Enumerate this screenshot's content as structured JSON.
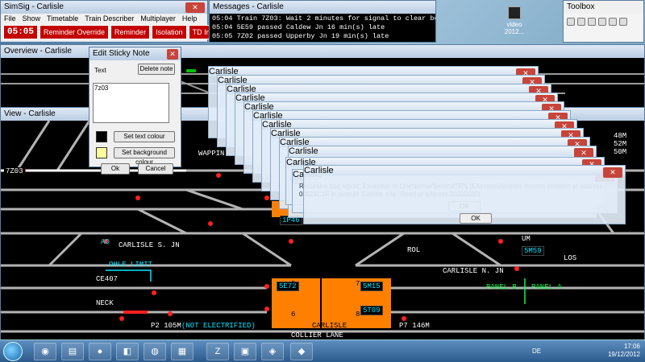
{
  "simsig": {
    "title": "SimSig - Carlisle",
    "menu": [
      "File",
      "Show",
      "Timetable",
      "Train Describer",
      "Multiplayer",
      "Help"
    ],
    "clock": "05:05",
    "buttons": [
      "Reminder Override",
      "Reminder",
      "Isolation",
      "TD Interpose"
    ]
  },
  "messages": {
    "title": "Messages - Carlisle",
    "lines": [
      "05:04 Train 7Z03: Wait 2 minutes for signal to clear before phoning",
      "05:04 5E59 passed Caldew Jn 16 min(s) late",
      "05:05 7Z02 passed Upperby Jn 19 min(s) late"
    ]
  },
  "toolbox": {
    "title": "Toolbox"
  },
  "desktop_icon": {
    "label": "video 2012..."
  },
  "overview": {
    "title": "Overview - Carlisle"
  },
  "view": {
    "title": "View - Carlisle",
    "labels": {
      "carlisle_s_jn": "CARLISLE S. JN",
      "carlisle_n_jn": "CARLISLE N. JN",
      "ohle_limit": "OHLE LIMIT",
      "ce407": "CE407",
      "neck": "NECK",
      "carlisle": "CARLISLE",
      "wapping": "WAPPIN",
      "p2": "P2 105M",
      "not_electrified": "(NOT ELECTRIFIED)",
      "p7": "P7 146M",
      "rol": "ROL",
      "los": "LOS",
      "um": "UM",
      "panel_b": "PANEL B",
      "panel_a": "PANEL A",
      "m48": "48M",
      "m52": "52M",
      "m50": "50M",
      "collier_lane": "COLLIER LANE",
      "ao": "AO"
    },
    "berths": {
      "b7z03": "7Z03",
      "b1p46": "1P46",
      "b5e72": "5E72",
      "b5m15": "5M15",
      "b5t09": "5T09",
      "b5m59": "5M59",
      "b5p6": "5",
      "b7p": "7",
      "b6p": "6",
      "b8p": "8"
    }
  },
  "sticky": {
    "title": "Edit Sticky Note",
    "text_label": "Text",
    "delete_label": "Delete note",
    "note_text": "7z03",
    "text_colour_label": "Set text colour",
    "bg_colour_label": "Set background colour",
    "ok_label": "Ok",
    "cancel_label": "Cancel",
    "text_colour": "#000000",
    "bg_colour": "#ffffa0"
  },
  "errors": {
    "window_title": "Carlisle",
    "message": "Recursive bug report: Exception in OneNormalSecondTRN (EAccessViolation: Access violation at address 00524C1F in module 'Carlisle.exe'. Read of address 00000000)",
    "ok_label": "OK"
  },
  "taskbar": {
    "lang": "DE",
    "time": "17:06",
    "date": "19/12/2012"
  }
}
